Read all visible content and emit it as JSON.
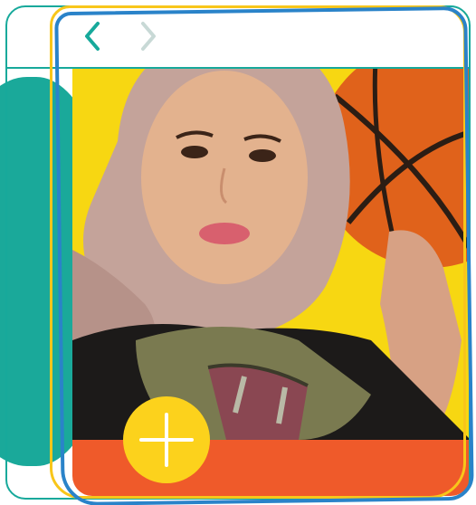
{
  "viewer": {
    "prev_icon": "chevron-left-icon",
    "next_icon": "chevron-right-icon",
    "add_icon": "plus-icon"
  },
  "colors": {
    "teal": "#17a99b",
    "yellow": "#f8d40f",
    "orange": "#ef5a2a",
    "blue": "#2a83c9",
    "prev_arrow": "#17a99b",
    "next_arrow": "#c8d9d6"
  }
}
